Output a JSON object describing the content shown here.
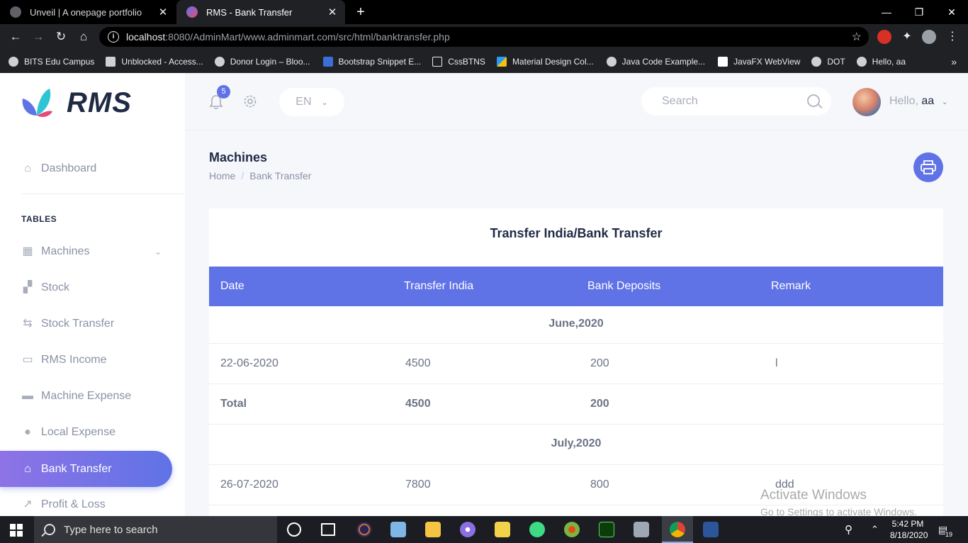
{
  "browser": {
    "tabs": [
      {
        "title": "Unveil | A onepage portfolio",
        "active": false
      },
      {
        "title": "RMS - Bank Transfer",
        "active": true
      }
    ],
    "url_host": "localhost",
    "url_rest": ":8080/AdminMart/www.adminmart.com/src/html/banktransfer.php",
    "bookmarks": [
      "BITS Edu Campus",
      "Unblocked - Access...",
      "Donor Login – Bloo...",
      "Bootstrap Snippet E...",
      "CssBTNS",
      "Material Design Col...",
      "Java Code Example...",
      "JavaFX WebView",
      "DOT",
      "Hello, aa"
    ],
    "bookmarks_overflow": "»"
  },
  "app": {
    "logo_text": "RMS",
    "header": {
      "notification_count": "5",
      "language": "EN",
      "search_placeholder": "Search",
      "greeting": "Hello,",
      "username": "aa"
    },
    "sidebar": {
      "dashboard": "Dashboard",
      "section_caption": "TABLES",
      "items": [
        {
          "label": "Machines",
          "icon": "grid-icon"
        },
        {
          "label": "Stock",
          "icon": "boxes-icon"
        },
        {
          "label": "Stock Transfer",
          "icon": "transfer-icon"
        },
        {
          "label": "RMS Income",
          "icon": "folder-icon"
        },
        {
          "label": "Machine Expense",
          "icon": "truck-icon"
        },
        {
          "label": "Local Expense",
          "icon": "user-icon"
        },
        {
          "label": "Bank Transfer",
          "icon": "bank-icon"
        },
        {
          "label": "Profit & Loss",
          "icon": "chart-icon"
        }
      ]
    },
    "page_title": "Machines",
    "breadcrumb": {
      "home": "Home",
      "separator": "/",
      "current": "Bank Transfer"
    },
    "card_title": "Transfer India/Bank Transfer",
    "table": {
      "columns": [
        "Date",
        "Transfer India",
        "Bank Deposits",
        "Remark"
      ],
      "rows": [
        {
          "type": "group",
          "label": "June,2020"
        },
        {
          "type": "data",
          "date": "22-06-2020",
          "transfer_india": "4500",
          "bank_deposits": "200",
          "remark": "l"
        },
        {
          "type": "total",
          "date": "Total",
          "transfer_india": "4500",
          "bank_deposits": "200",
          "remark": ""
        },
        {
          "type": "group",
          "label": "July,2020"
        },
        {
          "type": "data",
          "date": "26-07-2020",
          "transfer_india": "7800",
          "bank_deposits": "800",
          "remark": "ddd"
        }
      ]
    }
  },
  "watermark": {
    "line1": "Activate Windows",
    "line2": "Go to Settings to activate Windows."
  },
  "taskbar": {
    "search_placeholder": "Type here to search",
    "time": "5:42 PM",
    "date": "8/18/2020",
    "notification_count": "19"
  },
  "colors": {
    "accent": "#5f73e6",
    "accent_purple": "#8e73e6",
    "heading": "#1f2a44",
    "muted": "#8a92a6"
  }
}
